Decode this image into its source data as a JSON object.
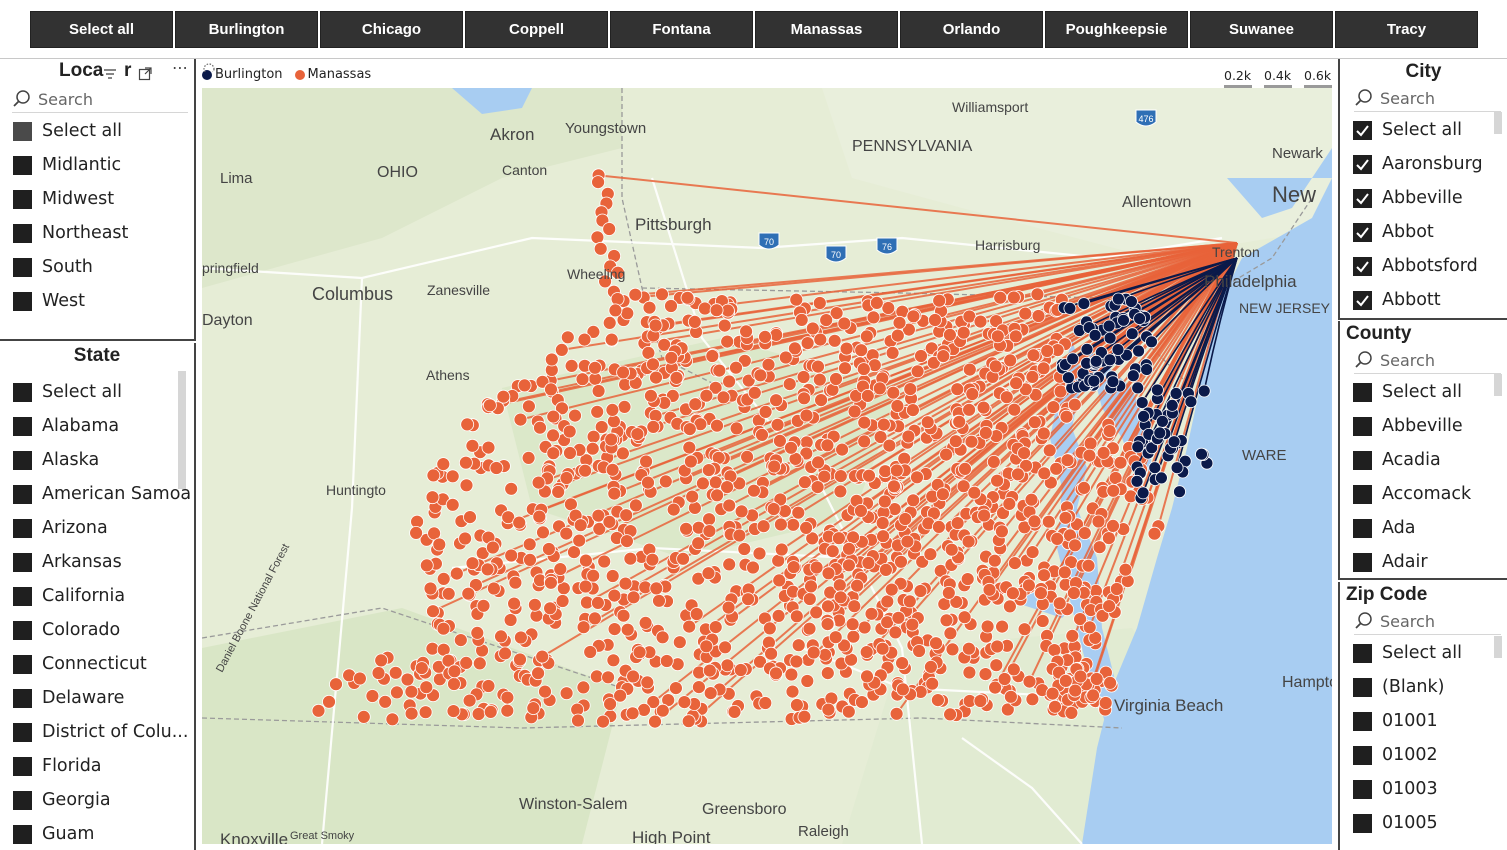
{
  "top_buttons": [
    "Select all",
    "Burlington",
    "Chicago",
    "Coppell",
    "Fontana",
    "Manassas",
    "Orlando",
    "Poughkeepsie",
    "Suwanee",
    "Tracy"
  ],
  "location_slicer": {
    "title": "Loca",
    "title_tail": "r",
    "search_placeholder": "Search",
    "items": [
      "Select all",
      "Midlantic",
      "Midwest",
      "Northeast",
      "South",
      "West"
    ]
  },
  "state_slicer": {
    "title": "State",
    "search_placeholder": "Search",
    "items": [
      "Select all",
      "Alabama",
      "Alaska",
      "American Samoa",
      "Arizona",
      "Arkansas",
      "California",
      "Colorado",
      "Connecticut",
      "Delaware",
      "District of Colu...",
      "Florida",
      "Georgia",
      "Guam"
    ]
  },
  "city_slicer": {
    "title": "City",
    "search_placeholder": "Search",
    "items": [
      "Select all",
      "Aaronsburg",
      "Abbeville",
      "Abbot",
      "Abbotsford",
      "Abbott"
    ]
  },
  "county_slicer": {
    "title": "County",
    "search_placeholder": "Search",
    "items": [
      "Select all",
      "Abbeville",
      "Acadia",
      "Accomack",
      "Ada",
      "Adair"
    ]
  },
  "zip_slicer": {
    "title": "Zip Code",
    "search_placeholder": "Search",
    "items": [
      "Select all",
      "(Blank)",
      "01001",
      "01002",
      "01003",
      "01005"
    ]
  },
  "map": {
    "legend": [
      {
        "name": "Burlington",
        "color": "#0b1a4a"
      },
      {
        "name": "Manassas",
        "color": "#e8633a"
      }
    ],
    "scale_labels": [
      "0.2k",
      "0.4k",
      "0.6k"
    ],
    "labels": [
      "Williamsport",
      "Akron",
      "Youngstown",
      "PENNSYLVANIA",
      "Newark",
      "New",
      "OHIO",
      "Canton",
      "Lima",
      "Allentown",
      "Pittsburgh",
      "Harrisburg",
      "Trenton",
      "Philadelphia",
      "pringfield",
      "Columbus",
      "Zanesville",
      "Wheeling",
      "NEW JERSEY",
      "Dayton",
      "Athens",
      "Huntingto",
      "WARE",
      "Hampton",
      "Virginia Beach",
      "Winston-Salem",
      "Greensboro",
      "Knoxville",
      "High Point",
      "Raleigh",
      "Daniel Boone National Forest",
      "Great Smoky"
    ],
    "highways": [
      "476",
      "70",
      "70",
      "76"
    ],
    "colors": {
      "land": "#e6edd6",
      "water": "#a8cdf2",
      "road": "#ffffff",
      "manassas": "#e8633a",
      "burlington": "#0b1a4a"
    }
  }
}
